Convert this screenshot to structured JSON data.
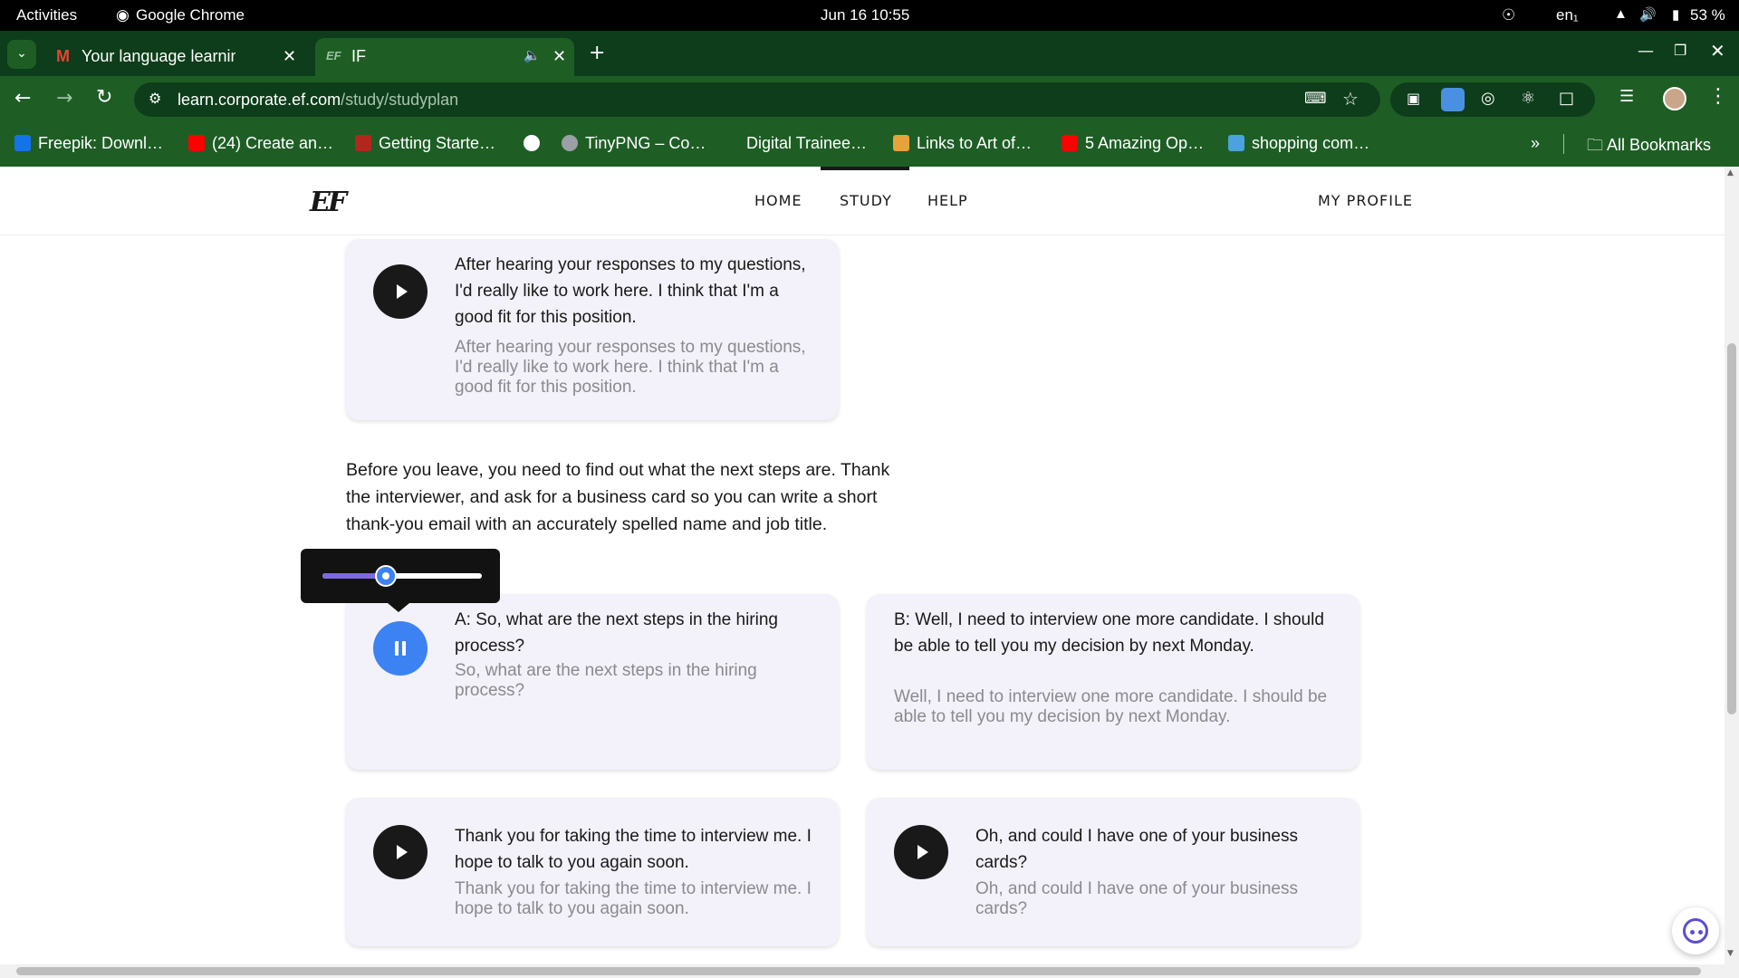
{
  "system": {
    "activities": "Activities",
    "app_name": "Google Chrome",
    "datetime": "Jun 16  10:55",
    "lang": "en₁",
    "battery": "53 %"
  },
  "browser": {
    "tabs": [
      {
        "title": "Your language learning c",
        "favicon": "gmail-icon"
      },
      {
        "title": "IF",
        "favicon": "ef-icon",
        "audio": true
      }
    ],
    "url_host": "learn.corporate.ef.com",
    "url_path": "/study/studyplan",
    "bookmarks": [
      {
        "label": "Freepik: Downl…",
        "color": "#1273eb"
      },
      {
        "label": "(24) Create an…",
        "color": "#ff0000"
      },
      {
        "label": "Getting Starte…",
        "color": "#b3261e"
      },
      {
        "label": "",
        "color": "#ffffff"
      },
      {
        "label": "TinyPNG – Co…",
        "color": "#9aa0a6"
      },
      {
        "label": "Digital Trainee…",
        "color": ""
      },
      {
        "label": "Links to Art of…",
        "color": "#e8a23a"
      },
      {
        "label": "5 Amazing Op…",
        "color": "#ff0000"
      },
      {
        "label": "shopping com…",
        "color": "#4aa3df"
      }
    ],
    "all_bookmarks": "All Bookmarks"
  },
  "site": {
    "logo": "EF",
    "nav": [
      "HOME",
      "STUDY",
      "HELP"
    ],
    "active_nav": "STUDY",
    "profile": "MY PROFILE"
  },
  "content": {
    "card_top": {
      "text": "After hearing your responses to my questions, I'd really like to work here. I think that I'm a good fit for this position.",
      "translation": "After hearing your responses to my questions, I'd really like to work here. I think that I'm a good fit for this position."
    },
    "paragraph": "Before you leave, you need to find out what the next steps are. Thank the interviewer, and ask for a business card so you can write a short thank-you email with an accurately spelled name and job title.",
    "volume_level": 0.44,
    "cards": [
      {
        "text": "A: So, what are the next steps in the hiring process?",
        "translation": "So, what are the next steps in the hiring process?",
        "playing": true,
        "has_button": true
      },
      {
        "text": "B: Well, I need to interview one more candidate. I should be able to tell you my decision by next Monday.",
        "translation": "Well, I need to interview one more candidate. I should be able to tell you my decision by next Monday.",
        "playing": false,
        "has_button": false
      },
      {
        "text": "Thank you for taking the time to interview me. I hope to talk to you again soon.",
        "translation": "Thank you for taking the time to interview me. I hope to talk to you again soon.",
        "playing": false,
        "has_button": true
      },
      {
        "text": "Oh, and could I have one of your business cards?",
        "translation": "Oh, and could I have one of your business cards?",
        "playing": false,
        "has_button": true
      }
    ]
  }
}
